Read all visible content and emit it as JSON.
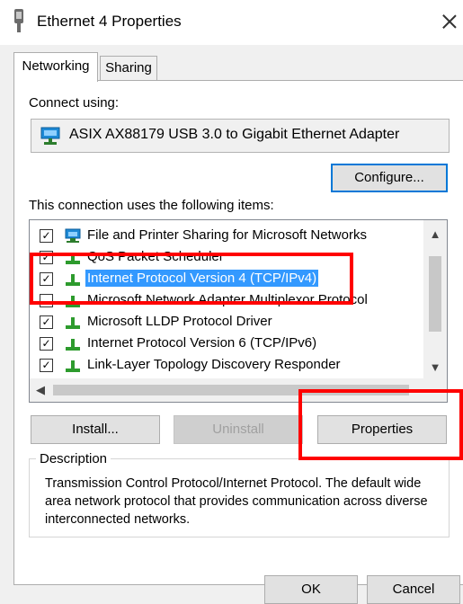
{
  "window": {
    "title": "Ethernet 4 Properties",
    "icon": "network-adapter-icon",
    "close_icon": "close-icon"
  },
  "tabs": [
    {
      "label": "Networking",
      "active": true
    },
    {
      "label": "Sharing",
      "active": false
    }
  ],
  "connect": {
    "label": "Connect using:",
    "adapter": "ASIX AX88179 USB 3.0 to Gigabit Ethernet Adapter"
  },
  "configure_button": "Configure...",
  "items_label": "This connection uses the following items:",
  "items": [
    {
      "label": "File and Printer Sharing for Microsoft Networks",
      "checked": true,
      "icon": "network-share-icon"
    },
    {
      "label": "QoS Packet Scheduler",
      "checked": true,
      "icon": "network-protocol-icon"
    },
    {
      "label": "Internet Protocol Version 4 (TCP/IPv4)",
      "checked": true,
      "selected": true,
      "icon": "network-protocol-icon"
    },
    {
      "label": "Microsoft Network Adapter Multiplexor Protocol",
      "checked": false,
      "icon": "network-protocol-icon"
    },
    {
      "label": "Microsoft LLDP Protocol Driver",
      "checked": true,
      "icon": "network-protocol-icon"
    },
    {
      "label": "Internet Protocol Version 6 (TCP/IPv6)",
      "checked": true,
      "icon": "network-protocol-icon"
    },
    {
      "label": "Link-Layer Topology Discovery Responder",
      "checked": true,
      "icon": "network-protocol-icon"
    }
  ],
  "buttons": {
    "install": "Install...",
    "uninstall": "Uninstall",
    "properties": "Properties",
    "ok": "OK",
    "cancel": "Cancel"
  },
  "description": {
    "title": "Description",
    "text": "Transmission Control Protocol/Internet Protocol. The default wide area network protocol that provides communication across diverse interconnected networks."
  },
  "colors": {
    "selection": "#3399ff",
    "highlight": "#ff0000",
    "accent": "#0078d7"
  }
}
